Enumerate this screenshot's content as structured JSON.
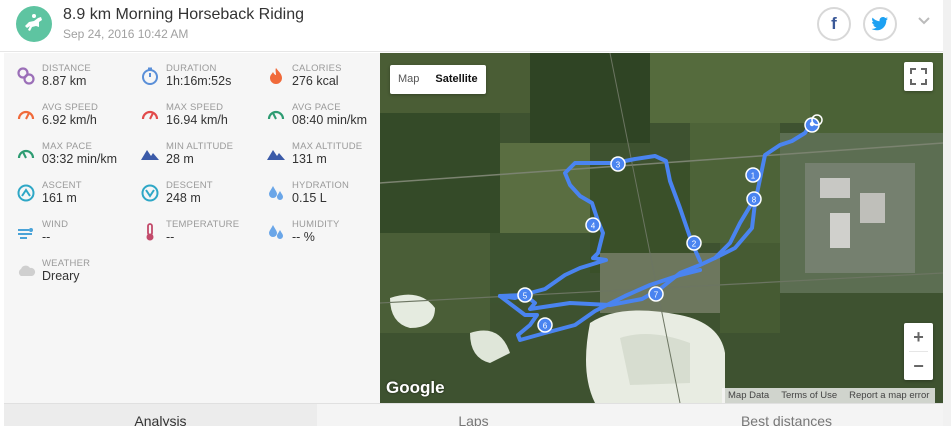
{
  "header": {
    "title": "8.9 km Morning Horseback Riding",
    "date": "Sep 24, 2016 10:42 AM",
    "facebook_label": "f"
  },
  "stats": [
    {
      "label": "DISTANCE",
      "value": "8.87 km",
      "icon": "distance-icon",
      "color": "#9b6fb8"
    },
    {
      "label": "DURATION",
      "value": "1h:16m:52s",
      "icon": "stopwatch-icon",
      "color": "#5a8fd8"
    },
    {
      "label": "CALORIES",
      "value": "276 kcal",
      "icon": "flame-icon",
      "color": "#f06a3a"
    },
    {
      "label": "AVG SPEED",
      "value": "6.92 km/h",
      "icon": "speedometer-icon",
      "color": "#f06a3a"
    },
    {
      "label": "MAX SPEED",
      "value": "16.94 km/h",
      "icon": "speedometer-icon",
      "color": "#e24b4b"
    },
    {
      "label": "AVG PACE",
      "value": "08:40 min/km",
      "icon": "pace-icon",
      "color": "#2e9c72"
    },
    {
      "label": "MAX PACE",
      "value": "03:32 min/km",
      "icon": "pace-icon",
      "color": "#2e9c72"
    },
    {
      "label": "MIN ALTITUDE",
      "value": "28 m",
      "icon": "mountain-icon",
      "color": "#3b5aa8"
    },
    {
      "label": "MAX ALTITUDE",
      "value": "131 m",
      "icon": "mountain-icon",
      "color": "#3b5aa8"
    },
    {
      "label": "ASCENT",
      "value": "161 m",
      "icon": "ascent-icon",
      "color": "#2ea7c6"
    },
    {
      "label": "DESCENT",
      "value": "248 m",
      "icon": "descent-icon",
      "color": "#2ea7c6"
    },
    {
      "label": "HYDRATION",
      "value": "0.15 L",
      "icon": "drops-icon",
      "color": "#6aa6e8"
    },
    {
      "label": "WIND",
      "value": "--",
      "icon": "wind-icon",
      "color": "#4aa3d8"
    },
    {
      "label": "TEMPERATURE",
      "value": "--",
      "icon": "thermometer-icon",
      "color": "#c24a6a"
    },
    {
      "label": "HUMIDITY",
      "value": "-- %",
      "icon": "drops-icon",
      "color": "#6aa6e8"
    },
    {
      "label": "WEATHER",
      "value": "Dreary",
      "icon": "cloud-icon",
      "color": "#cfcfcf"
    }
  ],
  "map": {
    "map_label": "Map",
    "satellite_label": "Satellite",
    "zoom_in": "+",
    "zoom_out": "−",
    "google": "Google",
    "map_data": "Map Data",
    "terms": "Terms of Use",
    "report": "Report a map error",
    "markers": [
      "1",
      "2",
      "3",
      "4",
      "5",
      "6",
      "7",
      "8"
    ],
    "route_color": "#4a84f0"
  },
  "tabs": [
    "Analysis",
    "Laps",
    "Best distances"
  ]
}
